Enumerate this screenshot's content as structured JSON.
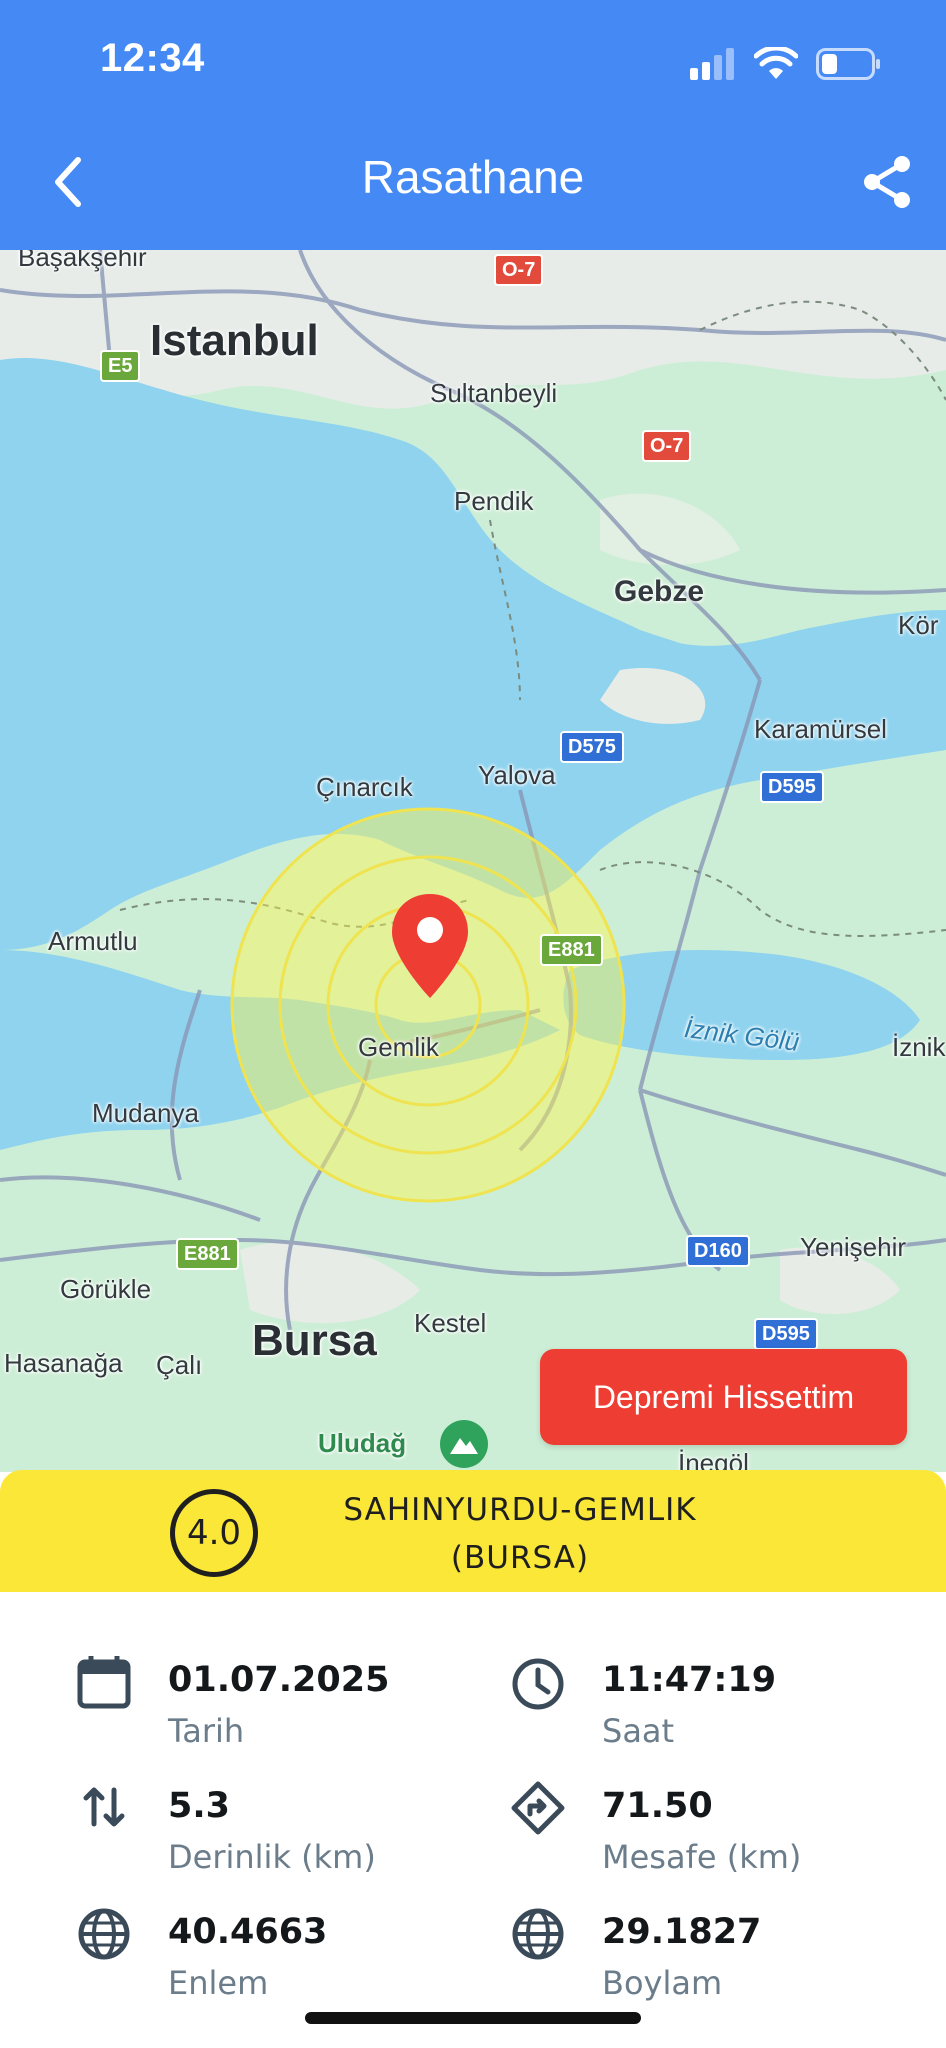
{
  "status_bar": {
    "time": "12:34"
  },
  "nav": {
    "title": "Rasathane"
  },
  "map": {
    "labels": {
      "basaksehir": "Başakşehir",
      "istanbul": "Istanbul",
      "sultanbeyli": "Sultanbeyli",
      "pendik": "Pendik",
      "gebze": "Gebze",
      "korfez": "Kör",
      "karamursel": "Karamürsel",
      "yalova": "Yalova",
      "cinarcik": "Çınarcık",
      "armutlu": "Armutlu",
      "gemlik": "Gemlik",
      "iznik_golu": "İznik Gölü",
      "iznik": "İznik",
      "mudanya": "Mudanya",
      "gorukle": "Görükle",
      "bursa": "Bursa",
      "kestel": "Kestel",
      "yenisehir": "Yenişehir",
      "hasanaga": "Hasanağa",
      "cali": "Çalı",
      "uludag": "Uludağ",
      "inegol": "İnegöl"
    },
    "shields": {
      "o7_top": "O-7",
      "o7_mid": "O-7",
      "e5": "E5",
      "d575": "D575",
      "d595_top": "D595",
      "e881_right": "E881",
      "e881_left": "E881",
      "d160": "D160",
      "d595_bottom": "D595"
    }
  },
  "actions": {
    "felt_it": "Depremi Hissettim"
  },
  "quake": {
    "magnitude": "4.0",
    "location_line1": "SAHINYURDU-GEMLIK",
    "location_line2": "(BURSA)"
  },
  "details": {
    "date": {
      "value": "01.07.2025",
      "label": "Tarih"
    },
    "time": {
      "value": "11:47:19",
      "label": "Saat"
    },
    "depth": {
      "value": "5.3",
      "label": "Derinlik (km)"
    },
    "distance": {
      "value": "71.50",
      "label": "Mesafe (km)"
    },
    "latitude": {
      "value": "40.4663",
      "label": "Enlem"
    },
    "longitude": {
      "value": "29.1827",
      "label": "Boylam"
    }
  },
  "colors": {
    "header": "#4589f5",
    "banner": "#fbe737",
    "button": "#ee3e33",
    "pin": "#ee3e33",
    "water": "#8fd3ef",
    "land": "#c9f0d5"
  },
  "icons": {
    "back": "chevron-left-icon",
    "share": "share-icon",
    "date": "calendar-icon",
    "time": "clock-icon",
    "depth": "arrows-up-down-icon",
    "distance": "direction-icon",
    "latitude": "globe-icon",
    "longitude": "globe-icon",
    "pin": "map-pin-icon"
  }
}
